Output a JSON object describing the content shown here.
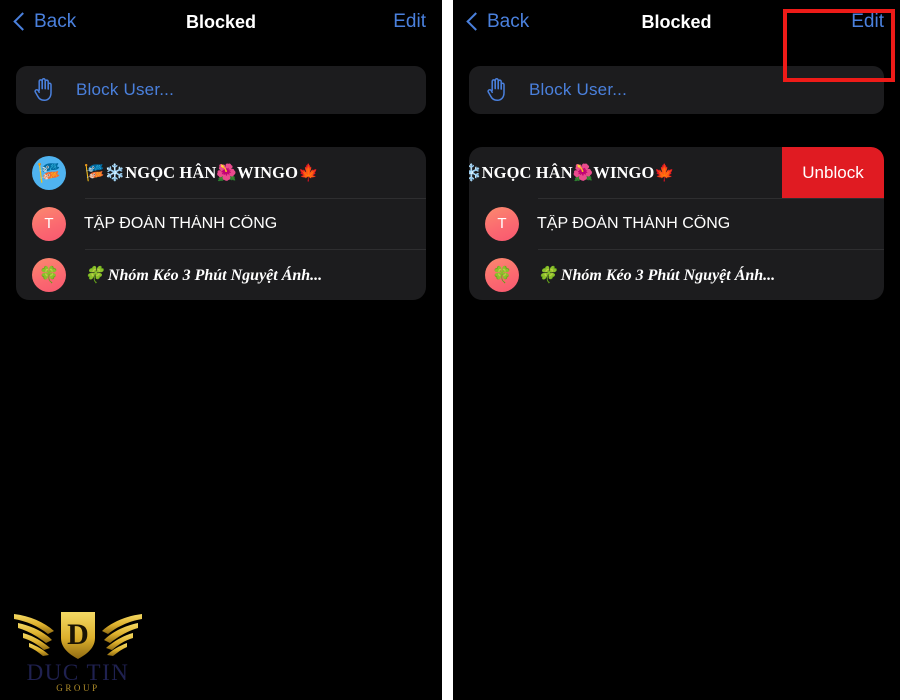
{
  "screen": {
    "nav": {
      "back_label": "Back",
      "title": "Blocked",
      "edit_label": "Edit"
    },
    "block_user": {
      "label": "Block User...",
      "icon": "raised-hand-icon"
    },
    "blocked_list": [
      {
        "avatar_type": "emoji",
        "avatar_glyph": "🎏",
        "avatar_color": "#4fb3f0",
        "label": "🎏❄️NGỌC HÂN🌺WINGO🍁",
        "label_style": "serif"
      },
      {
        "avatar_type": "letter",
        "avatar_glyph": "T",
        "avatar_color": "#fb6a70",
        "label": "TẬP ĐOÀN THÀNH CÔNG",
        "label_style": "sans"
      },
      {
        "avatar_type": "emoji",
        "avatar_glyph": "🍀",
        "avatar_color": "#fb6a70",
        "label": "🍀 Nhóm Kéo 3 Phút Nguyệt Ánh...",
        "label_style": "script"
      }
    ]
  },
  "right_screen": {
    "swiped_row": {
      "label": "❄️NGỌC HÂN🌺WINGO🍁",
      "unblock_label": "Unblock",
      "unblock_color": "#e01b22"
    },
    "annotation": {
      "shape": "rectangle",
      "color": "#ee1b18"
    }
  },
  "watermark": {
    "brand": "DUC TIN",
    "sub": "GROUP",
    "brand_color": "#1f2150",
    "sub_color": "#b08d2a",
    "wing_color": "#e8c045"
  },
  "theme": {
    "background": "#000000",
    "card": "#1c1c1e",
    "accent_blue": "#4a80dd",
    "text": "#ffffff",
    "separator": "#2e2e30",
    "divider": "#ffffff"
  }
}
